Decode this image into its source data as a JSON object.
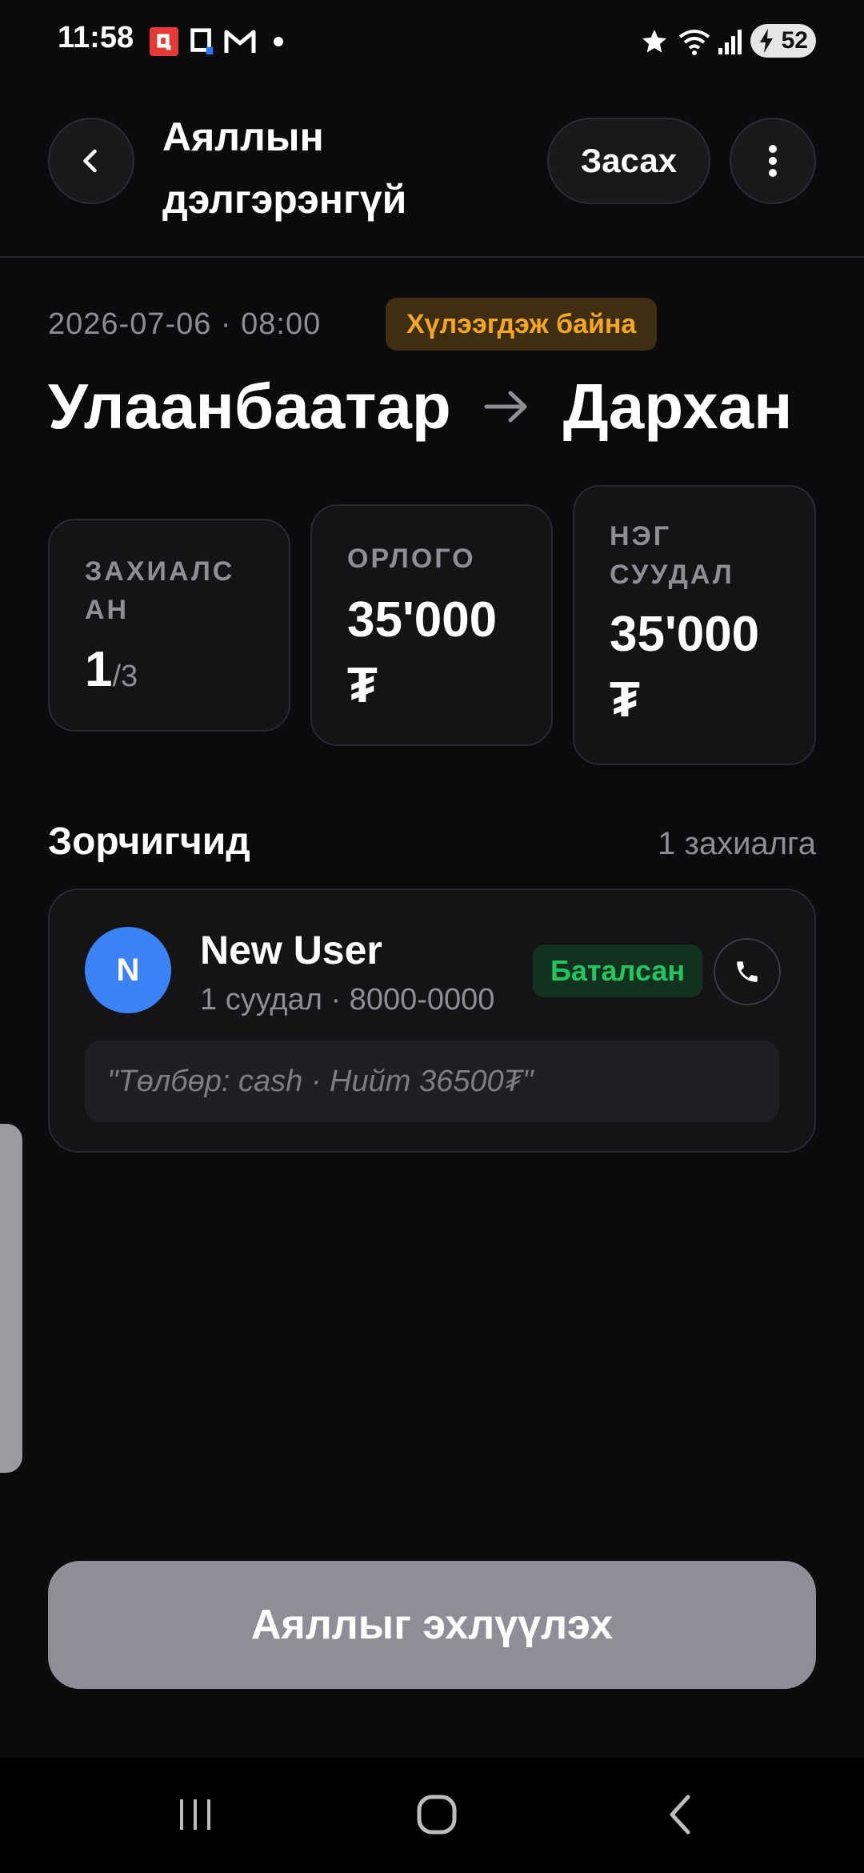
{
  "status_bar": {
    "time": "11:58",
    "battery": "52",
    "icons": [
      "notification-app-icon",
      "qr-app-icon",
      "gmail-icon",
      "star-icon",
      "wifi-icon",
      "signal-icon",
      "battery-icon"
    ]
  },
  "header": {
    "title": "Аяллын дэлгэрэнгүй",
    "edit_label": "Засах",
    "icons": [
      "back-chevron-icon",
      "more-vertical-icon"
    ]
  },
  "trip": {
    "datetime": "2026-07-06 · 08:00",
    "status": "Хүлээгдэж байна",
    "from": "Улаанбаатар",
    "to": "Дархан"
  },
  "stats": {
    "booked_label": "ЗАХИАЛСАН",
    "booked_value": "1",
    "booked_total": "/3",
    "income_label": "ОРЛОГО",
    "income_value": "35'000₮",
    "per_seat_label": "НЭГ СУУДАЛ",
    "per_seat_value": "35'000₮"
  },
  "passengers": {
    "title": "Зорчигчид",
    "count": "1 захиалга",
    "items": [
      {
        "initial": "N",
        "name": "New User",
        "details": "1 суудал · 8000-0000",
        "status": "Баталсан",
        "note": "\"Төлбөр: cash · Нийт 36500₮\""
      }
    ]
  },
  "actions": {
    "start_trip": "Аяллыг эхлүүлэх"
  },
  "colors": {
    "background": "#0b0b0d",
    "card": "#141417",
    "pending": "#f5a623",
    "confirmed": "#22c55e",
    "avatar": "#3b82f6",
    "disabled_button": "#8e8e99"
  }
}
